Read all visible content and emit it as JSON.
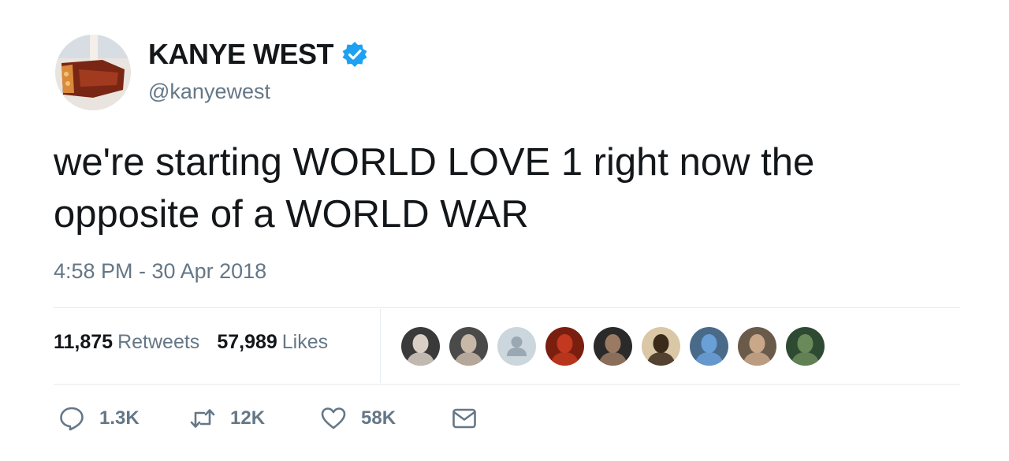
{
  "user": {
    "display_name": "KANYE WEST",
    "handle": "@kanyewest",
    "verified": true,
    "avatar_icon": "profile-avatar"
  },
  "tweet": {
    "text": "we're starting WORLD LOVE 1 right now the opposite of a WORLD WAR",
    "timestamp": "4:58 PM - 30 Apr 2018"
  },
  "stats": {
    "retweets_count": "11,875",
    "retweets_label": "Retweets",
    "likes_count": "57,989",
    "likes_label": "Likes"
  },
  "likers": [
    {
      "icon": "avatar-woman-glasses",
      "bg": "#3a3a3a",
      "fg": "#d9cfc5"
    },
    {
      "icon": "avatar-woman",
      "bg": "#4a4a4a",
      "fg": "#c8b8a8"
    },
    {
      "icon": "default-avatar",
      "bg": "#ccd6dd",
      "fg": "#9aa8b4"
    },
    {
      "icon": "avatar-red",
      "bg": "#7a1f10",
      "fg": "#c2391f"
    },
    {
      "icon": "avatar-dark",
      "bg": "#2a2a2a",
      "fg": "#9b7a63"
    },
    {
      "icon": "avatar-woman-gold",
      "bg": "#d9c7a6",
      "fg": "#3a2a1a"
    },
    {
      "icon": "avatar-blue-shirt",
      "bg": "#4a6a8a",
      "fg": "#6aa0d8"
    },
    {
      "icon": "avatar-man",
      "bg": "#6a5a4a",
      "fg": "#c9a88a"
    },
    {
      "icon": "avatar-green",
      "bg": "#2f4a32",
      "fg": "#6a8a5a"
    }
  ],
  "actions": {
    "reply_count": "1.3K",
    "retweet_count": "12K",
    "like_count": "58K"
  },
  "colors": {
    "verified_blue": "#1da1f2",
    "secondary_text": "#657786",
    "divider": "#e6ecf0"
  }
}
